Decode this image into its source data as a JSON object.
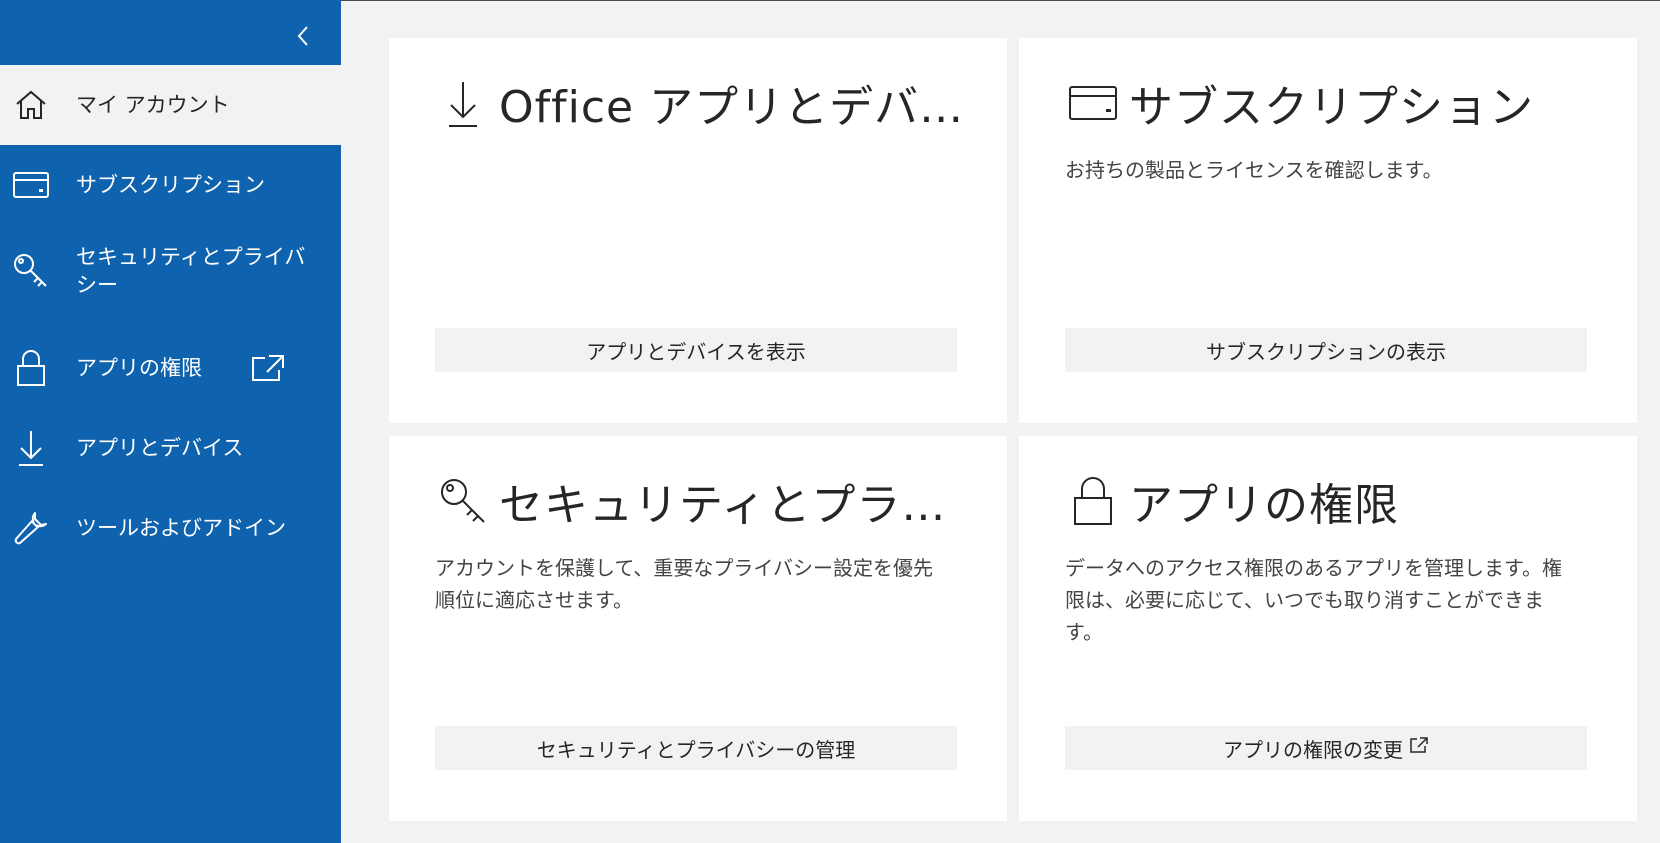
{
  "sidebar": {
    "collapse_icon": "chevron-left-icon",
    "items": [
      {
        "label": "マイ アカウント",
        "icon": "home-icon",
        "active": true
      },
      {
        "label": "サブスクリプション",
        "icon": "card-icon"
      },
      {
        "label": "セキュリティとプライバシー",
        "icon": "key-icon"
      },
      {
        "label": "アプリの権限",
        "icon": "lock-icon",
        "external_icon": "external-link-icon"
      },
      {
        "label": "アプリとデバイス",
        "icon": "download-icon"
      },
      {
        "label": "ツールおよびアドイン",
        "icon": "wrench-icon"
      }
    ]
  },
  "cards": {
    "apps": {
      "title": "Office アプリとデバイス",
      "icon": "download-icon",
      "description": "",
      "button": "アプリとデバイスを表示"
    },
    "subscriptions": {
      "title": "サブスクリプション",
      "icon": "card-icon",
      "description": "お持ちの製品とライセンスを確認します。",
      "button": "サブスクリプションの表示"
    },
    "security": {
      "title": "セキュリティとプライ...",
      "icon": "key-icon",
      "description": "アカウントを保護して、重要なプライバシー設定を優先順位に適応させます。",
      "button": "セキュリティとプライバシーの管理"
    },
    "permissions": {
      "title": "アプリの権限",
      "icon": "lock-icon",
      "description": "データへのアクセス権限のあるアプリを管理します。権限は、必要に応じて、いつでも取り消すことができます。",
      "button": "アプリの権限の変更",
      "button_icon": "external-link-icon"
    }
  },
  "colors": {
    "sidebar_bg": "#0f62ad",
    "page_bg": "#f2f2f2",
    "card_bg": "#ffffff",
    "button_bg": "#f2f2f2",
    "text": "#262626"
  }
}
